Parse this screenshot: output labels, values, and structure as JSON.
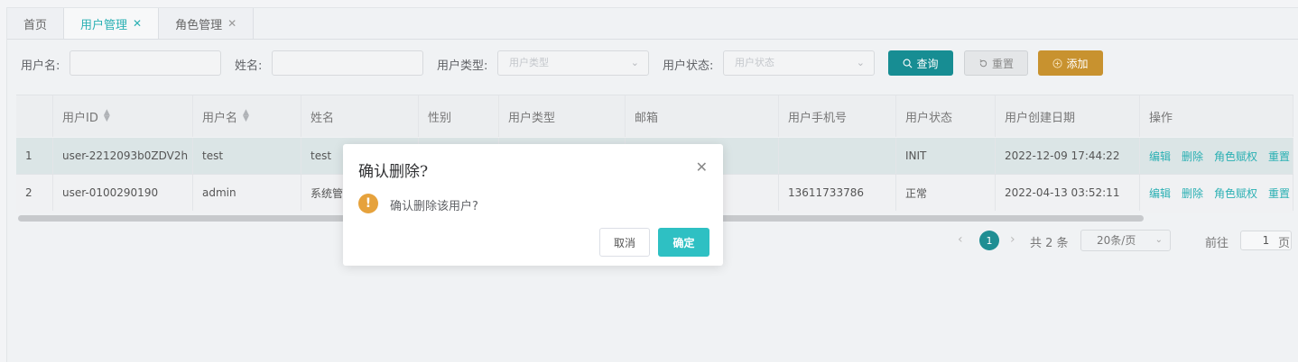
{
  "tabs": [
    {
      "label": "首页",
      "close": ""
    },
    {
      "label": "用户管理",
      "close": "✕"
    },
    {
      "label": "角色管理",
      "close": "✕"
    }
  ],
  "search": {
    "username_label": "用户名:",
    "username_value": "",
    "name_label": "姓名:",
    "name_value": "",
    "type_label": "用户类型:",
    "type_placeholder": "用户类型",
    "status_label": "用户状态:",
    "status_placeholder": "用户状态",
    "query": "查询",
    "reset": "重置",
    "add": "添加"
  },
  "table": {
    "columns": [
      "",
      "用户ID",
      "用户名",
      "姓名",
      "性别",
      "用户类型",
      "邮箱",
      "用户手机号",
      "用户状态",
      "用户创建日期",
      "操作"
    ],
    "rows": [
      {
        "idx": "1",
        "id": "user-2212093b0ZDV2h",
        "username": "test",
        "name": "test",
        "gender": "",
        "type": "",
        "email": "",
        "phone": "",
        "status": "INIT",
        "created": "2022-12-09 17:44:22"
      },
      {
        "idx": "2",
        "id": "user-0100290190",
        "username": "admin",
        "name": "系统管",
        "gender": "",
        "type": "",
        "email": "",
        "phone": "13611733786",
        "status": "正常",
        "created": "2022-04-13 03:52:11"
      }
    ],
    "ops": [
      "编辑",
      "删除",
      "角色赋权",
      "重置"
    ]
  },
  "pager": {
    "prev": "‹",
    "current": "1",
    "next": "›",
    "total": "共 2 条",
    "size": "20条/页",
    "goto": "前往",
    "page": "1",
    "unit": "页"
  },
  "dialog": {
    "title": "确认删除?",
    "close": "✕",
    "icon": "!",
    "message": "确认删除该用户?",
    "cancel": "取消",
    "ok": "确定"
  },
  "colors": {
    "accent": "#2ab0b3",
    "query": "#178d93",
    "add": "#c8922f",
    "warning": "#e6a23c"
  }
}
